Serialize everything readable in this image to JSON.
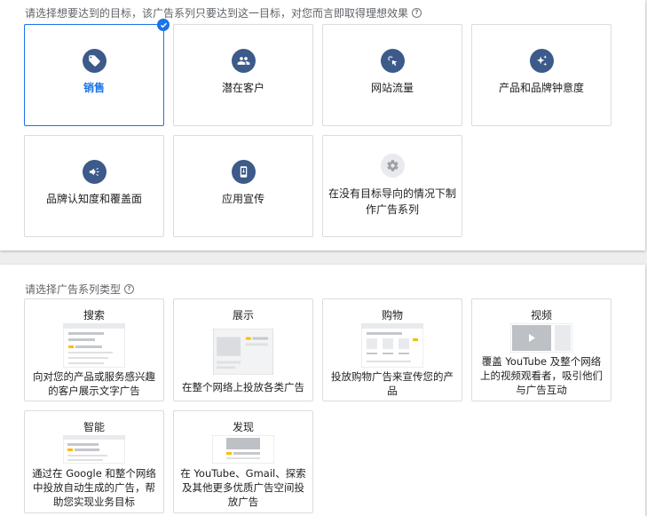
{
  "goal_section": {
    "title": "请选择想要达到的目标，该广告系列只要达到这一目标，对您而言即取得理想效果",
    "help": "?",
    "goals": [
      {
        "label": "销售",
        "icon": "tag-icon",
        "selected": true
      },
      {
        "label": "潜在客户",
        "icon": "people-icon",
        "selected": false
      },
      {
        "label": "网站流量",
        "icon": "click-cursor-icon",
        "selected": false
      },
      {
        "label": "产品和品牌钟意度",
        "icon": "sparkle-icon",
        "selected": false
      },
      {
        "label": "品牌认知度和覆盖面",
        "icon": "megaphone-icon",
        "selected": false
      },
      {
        "label": "应用宣传",
        "icon": "phone-download-icon",
        "selected": false
      },
      {
        "label": "在没有目标导向的情况下制作广告系列",
        "icon": "gear-icon",
        "selected": false
      }
    ]
  },
  "type_section": {
    "title": "请选择广告系列类型",
    "help": "?",
    "types": [
      {
        "title": "搜索",
        "desc": "向对您的产品或服务感兴趣的客户展示文字广告",
        "illustration": "search-ad-illustration"
      },
      {
        "title": "展示",
        "desc": "在整个网络上投放各类广告",
        "illustration": "display-ad-illustration"
      },
      {
        "title": "购物",
        "desc": "投放购物广告来宣传您的产品",
        "illustration": "shopping-ad-illustration"
      },
      {
        "title": "视频",
        "desc": "覆盖 YouTube 及整个网络上的视频观看者，吸引他们与广告互动",
        "illustration": "video-ad-illustration"
      },
      {
        "title": "智能",
        "desc": "通过在 Google 和整个网络中投放自动生成的广告，帮助您实现业务目标",
        "illustration": "smart-ad-illustration"
      },
      {
        "title": "发现",
        "desc": "在 YouTube、Gmail、探索及其他更多优质广告空间投放广告",
        "illustration": "discovery-ad-illustration"
      }
    ]
  },
  "colors": {
    "accent": "#1a73e8",
    "icon_circle": "#3c5a8a",
    "border": "#dadce0"
  }
}
